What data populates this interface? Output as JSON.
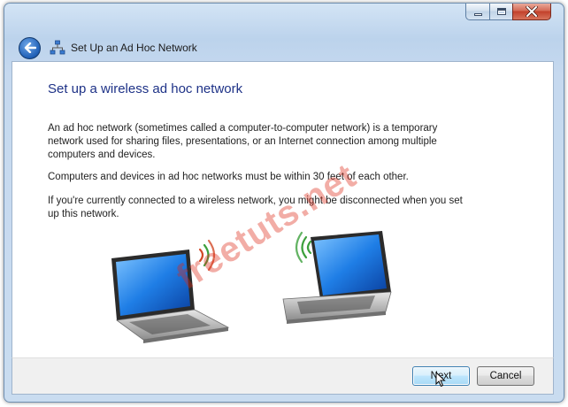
{
  "window": {
    "title": "Set Up an Ad Hoc Network",
    "controls": {
      "minimize": "minimize-icon",
      "maximize": "maximize-icon",
      "close": "close-icon"
    }
  },
  "page": {
    "heading": "Set up a wireless ad hoc network",
    "paragraphs": [
      "An ad hoc network (sometimes called a computer-to-computer network) is a temporary network used for sharing files, presentations, or an Internet connection among multiple computers and devices.",
      "Computers and devices in ad hoc networks must be within 30 feet of each other.",
      "If you're currently connected to a wireless network, you might be disconnected when you set up this network."
    ],
    "watermark": "freetuts.net"
  },
  "buttons": {
    "next": "Next",
    "cancel": "Cancel"
  },
  "colors": {
    "heading": "#1e3287",
    "frame": "#c9dcf0",
    "close_button": "#c2402a",
    "wireless_signal": "#3ca03c",
    "wireless_signal_alt": "#d24a28"
  }
}
